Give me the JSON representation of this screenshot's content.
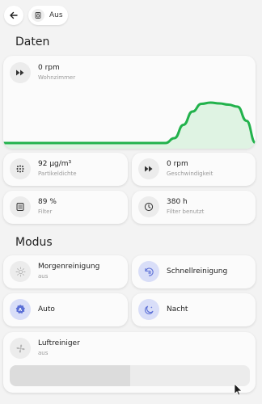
{
  "header": {
    "state_label": "Aus"
  },
  "sections": {
    "data_title": "Daten",
    "mode_title": "Modus"
  },
  "graph_card": {
    "value": "0 rpm",
    "label": "Wohnzimmer",
    "icon": "fast-forward-icon",
    "series": [
      0,
      0,
      0,
      0,
      0,
      0,
      0,
      0,
      0,
      0,
      0,
      0,
      0,
      0,
      0,
      0,
      0,
      0,
      0,
      0.12,
      0.45,
      0.78,
      0.97,
      1.0,
      0.98,
      0.95,
      0.9,
      0.55,
      0.0
    ],
    "line_color": "#22b24c",
    "fill_color": "#dff3e3"
  },
  "sensors": {
    "particles": {
      "value": "92 µg/m³",
      "label": "Partikeldichte",
      "icon": "dots-grid-icon"
    },
    "speed": {
      "value": "0 rpm",
      "label": "Geschwindigkeit",
      "icon": "fast-forward-icon"
    },
    "filter": {
      "value": "89 %",
      "label": "Filter",
      "icon": "filter-icon"
    },
    "filter_used": {
      "value": "380 h",
      "label": "Filter benutzt",
      "icon": "clock-icon"
    }
  },
  "modes": {
    "morning": {
      "label": "Morgenreinigung",
      "sublabel": "aus",
      "icon": "sun-icon",
      "active": false
    },
    "quick": {
      "label": "Schnellreinigung",
      "icon": "timer-icon",
      "active": true
    },
    "auto": {
      "label": "Auto",
      "icon": "auto-icon",
      "active": true
    },
    "night": {
      "label": "Nacht",
      "icon": "moon-icon",
      "active": true
    }
  },
  "purifier": {
    "label": "Luftreiniger",
    "sublabel": "aus",
    "icon": "fan-icon",
    "level": 0.5
  },
  "colors": {
    "accent": "#5b6fd6",
    "accent_bg": "#d9def8"
  }
}
